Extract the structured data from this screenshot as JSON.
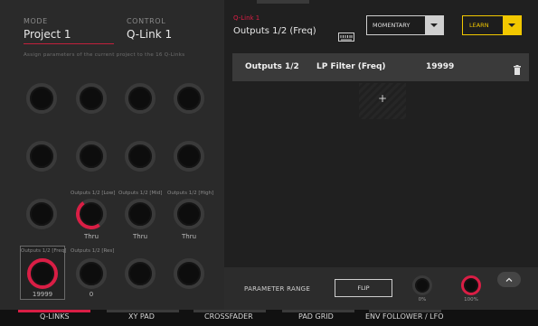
{
  "left": {
    "mode_label": "MODE",
    "mode_value": "Project 1",
    "control_label": "CONTROL",
    "control_value": "Q-Link 1",
    "hint": "Assign parameters of the current project to the 16 Q-Links",
    "knob_labels": {
      "r3k1": "Outputs 1/2 [Low]",
      "r3k2": "Outputs 1/2 [Mid]",
      "r3k3": "Outputs 1/2 [High]",
      "r4k0": "Outputs 1/2 [Freq]",
      "r4k1": "Outputs 1/2 [Res]"
    },
    "knob_values": {
      "r3k1": "Thru",
      "r3k2": "Thru",
      "r3k3": "Thru",
      "r4k0": "19999",
      "r4k1": "0"
    }
  },
  "right": {
    "qlink_label": "Q-Link 1",
    "qlink_value": "Outputs 1/2 (Freq)",
    "keyboard_icon": "keyboard-icon",
    "mode_select": "MOMENTARY",
    "learn_button": "LEARN",
    "row": {
      "target": "Outputs 1/2",
      "param": "LP Filter (Freq)",
      "value": "19999"
    },
    "add_symbol": "+",
    "param_range_label": "PARAMETER RANGE",
    "flip_button": "FLIP",
    "min_value": "0%",
    "max_value": "100%"
  },
  "tabs": [
    "Q-LINKS",
    "XY PAD",
    "CROSSFADER",
    "PAD GRID",
    "ENV FOLLOWER / LFO"
  ],
  "colors": {
    "accent": "#d91e45",
    "learn": "#f2c800"
  }
}
